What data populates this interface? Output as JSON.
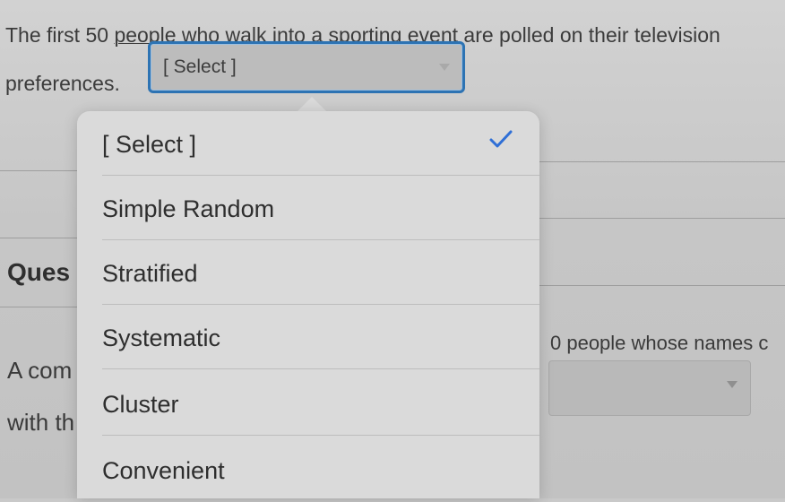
{
  "question": {
    "line1_prefix": "The first 50 ",
    "line1_underlined": "people who walk into a sporting",
    "line1_suffix": " event are polled on their television",
    "line2": "preferences.",
    "select_value": "[ Select ]"
  },
  "background": {
    "question_label": "Ques",
    "para_line1": "A com",
    "para_line2": "with th",
    "right_text": "0 people whose names c"
  },
  "dropdown": {
    "selected_index": 0,
    "accent_color": "#2f6fd6",
    "options": [
      {
        "label": "[ Select ]"
      },
      {
        "label": "Simple Random"
      },
      {
        "label": "Stratified"
      },
      {
        "label": "Systematic"
      },
      {
        "label": "Cluster"
      },
      {
        "label": "Convenient"
      }
    ]
  }
}
